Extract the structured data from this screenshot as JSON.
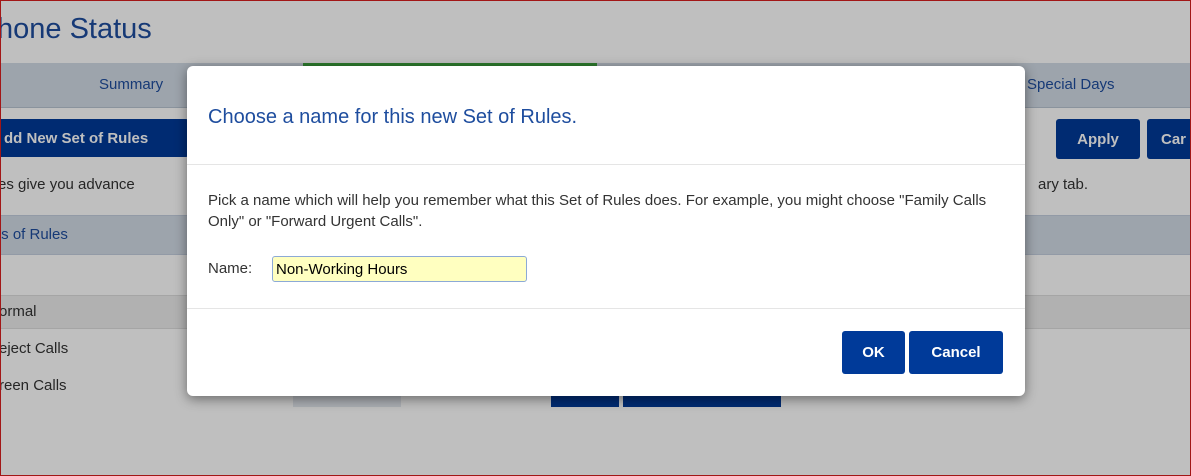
{
  "page": {
    "title": "hone Status",
    "tabs": [
      {
        "label": "Summary"
      },
      {
        "label": "Special Days"
      }
    ],
    "toolbar": {
      "add_set_label": "dd New Set of Rules",
      "apply_label": "Apply",
      "cancel_label": "Car"
    },
    "description_left": "es give you advance",
    "description_right": "ary tab.",
    "sets_header": "ts of Rules",
    "sets": [
      {
        "label": "ormal"
      },
      {
        "label": "eject Calls"
      },
      {
        "label": "reen Calls"
      }
    ],
    "colors": {
      "brand_blue": "#1e4d9e",
      "button_blue": "#003a99",
      "active_tab_green": "#3ba03b",
      "input_highlight": "#ffffc0"
    }
  },
  "dialog": {
    "title": "Choose a name for this new Set of Rules.",
    "body": "Pick a name which will help you remember what this Set of Rules does. For example, you might choose \"Family Calls Only\" or \"Forward Urgent Calls\".",
    "name_label": "Name:",
    "name_value": "Non-Working Hours",
    "ok_label": "OK",
    "cancel_label": "Cancel"
  }
}
